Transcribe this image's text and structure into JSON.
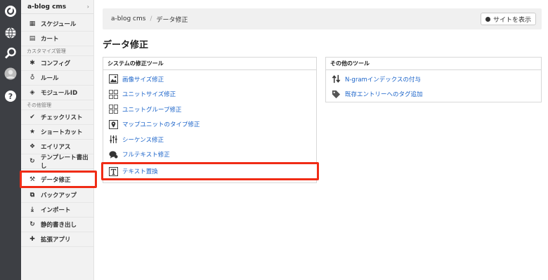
{
  "rail": {
    "icons": [
      "logo-icon",
      "globe-icon",
      "search-icon",
      "user-avatar-icon",
      "help-icon"
    ]
  },
  "sidebar": {
    "site_name": "a-blog cms",
    "arrow": "›",
    "items_top": [
      {
        "label": "スケジュール",
        "icon": "calendar-icon"
      },
      {
        "label": "カート",
        "icon": "cart-icon"
      }
    ],
    "section_customize": "カスタマイズ管理",
    "items_customize": [
      {
        "label": "コンフィグ",
        "icon": "gear-icon"
      },
      {
        "label": "ルール",
        "icon": "rule-icon"
      },
      {
        "label": "モジュールID",
        "icon": "module-icon"
      }
    ],
    "section_other": "その他管理",
    "items_other": [
      {
        "label": "チェックリスト",
        "icon": "check-icon"
      },
      {
        "label": "ショートカット",
        "icon": "star-icon"
      },
      {
        "label": "エイリアス",
        "icon": "alias-icon"
      },
      {
        "label": "テンプレート書出し",
        "icon": "refresh-icon"
      },
      {
        "label": "データ修正",
        "icon": "wrench-icon"
      },
      {
        "label": "バックアップ",
        "icon": "backup-icon"
      },
      {
        "label": "インポート",
        "icon": "import-icon"
      },
      {
        "label": "静的書き出し",
        "icon": "static-export-icon"
      },
      {
        "label": "拡張アプリ",
        "icon": "puzzle-icon"
      }
    ]
  },
  "header": {
    "breadcrumb_home": "a-blog cms",
    "breadcrumb_sep": "/",
    "breadcrumb_current": "データ修正",
    "view_site_button": "サイトを表示"
  },
  "main": {
    "title": "データ修正",
    "system_tools": {
      "heading": "システムの修正ツール",
      "items": [
        {
          "label": "画像サイズ修正",
          "icon": "image-icon"
        },
        {
          "label": "ユニットサイズ修正",
          "icon": "grid-icon"
        },
        {
          "label": "ユニットグループ修正",
          "icon": "grid-icon"
        },
        {
          "label": "マップユニットのタイプ修正",
          "icon": "map-pin-icon"
        },
        {
          "label": "シーケンス修正",
          "icon": "sliders-icon"
        },
        {
          "label": "フルテキスト修正",
          "icon": "speech-bubble-icon"
        },
        {
          "label": "テキスト置換",
          "icon": "text-icon"
        }
      ]
    },
    "other_tools": {
      "heading": "その他のツール",
      "items": [
        {
          "label": "N-gramインデックスの付与",
          "icon": "sort-arrows-icon"
        },
        {
          "label": "既存エントリーへのタグ追加",
          "icon": "tag-icon"
        }
      ]
    }
  },
  "colors": {
    "rail": "#3d3f44",
    "link": "#1a63c9",
    "highlight": "#f02c16"
  }
}
